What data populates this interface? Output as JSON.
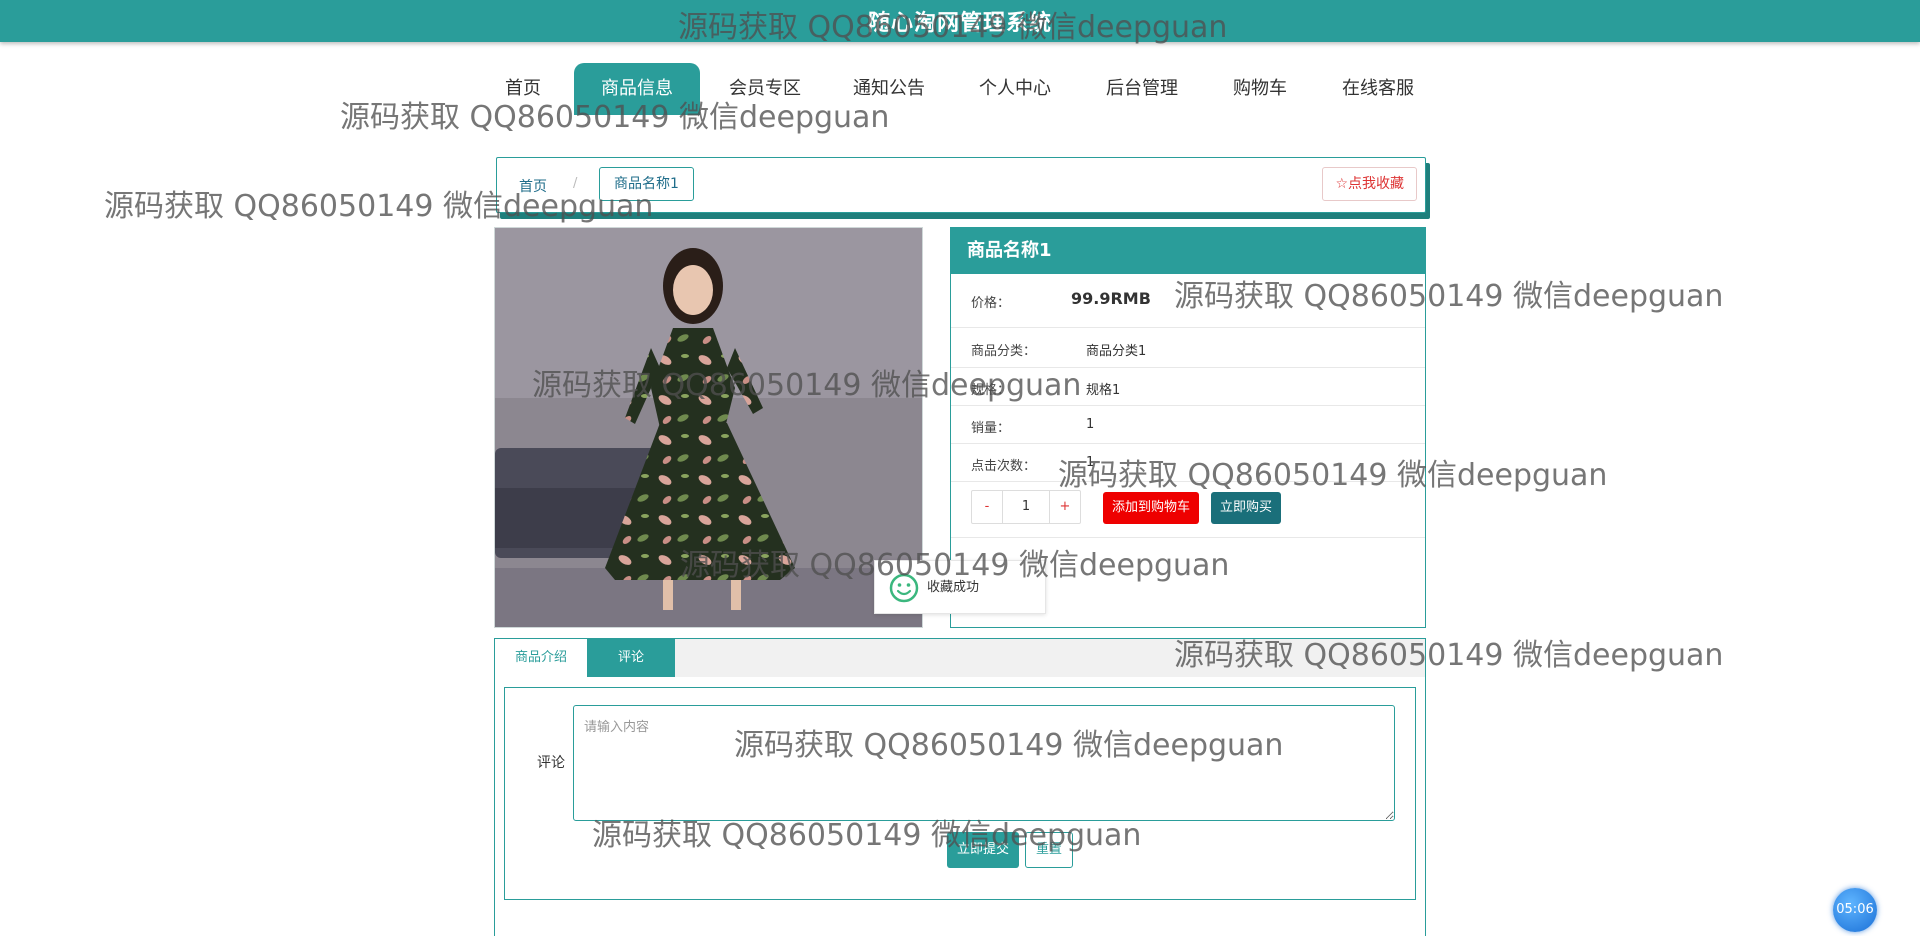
{
  "app": {
    "title": "随心淘网管理系统"
  },
  "nav": {
    "items": [
      {
        "label": "首页",
        "active": false
      },
      {
        "label": "商品信息",
        "active": true
      },
      {
        "label": "会员专区",
        "active": false
      },
      {
        "label": "通知公告",
        "active": false
      },
      {
        "label": "个人中心",
        "active": false
      },
      {
        "label": "后台管理",
        "active": false
      },
      {
        "label": "购物车",
        "active": false
      },
      {
        "label": "在线客服",
        "active": false
      }
    ]
  },
  "breadcrumb": {
    "home": "首页",
    "separator": "/",
    "current": "商品名称1"
  },
  "favorite_button": {
    "label": "☆点我收藏"
  },
  "product": {
    "name": "商品名称1",
    "price_label": "价格：",
    "price_value": "99.9RMB",
    "category_label": "商品分类：",
    "category_value": "商品分类1",
    "spec_label": "规格：",
    "spec_value": "规格1",
    "sales_label": "销量：",
    "sales_value": "1",
    "clicks_label": "点击次数：",
    "clicks_value": "1",
    "quantity": {
      "minus": "-",
      "value": "1",
      "plus": "+"
    },
    "add_to_cart": "添加到购物车",
    "buy_now": "立即购买"
  },
  "toast": {
    "message": "收藏成功",
    "icon": "smile-icon"
  },
  "tabs": [
    {
      "label": "商品介绍",
      "active": false
    },
    {
      "label": "评论",
      "active": true
    }
  ],
  "comment_form": {
    "label": "评论",
    "placeholder": "请输入内容",
    "value": "",
    "submit": "立即提交",
    "reset": "重置"
  },
  "timer": {
    "text": "05:06"
  },
  "watermark": {
    "text": "源码获取 QQ86050149 微信deepguan"
  },
  "colors": {
    "primary": "#2a9d9a",
    "price": "#dd1111",
    "cart": "#ee0000",
    "buy": "#1a6f7a"
  }
}
